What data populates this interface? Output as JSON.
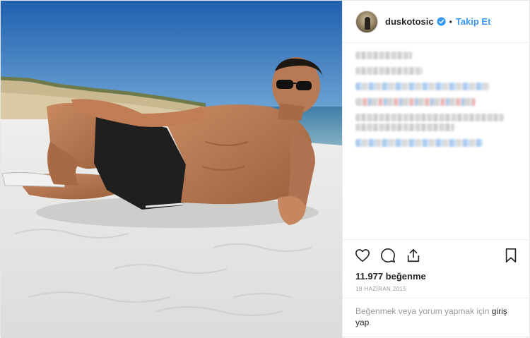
{
  "photo": {
    "description_icon": "beach-photo"
  },
  "header": {
    "username": "duskotosic",
    "separator": "•",
    "follow_label": "Takip Et"
  },
  "actions": {
    "like_icon": "heart-icon",
    "comment_icon": "comment-icon",
    "share_icon": "share-icon",
    "save_icon": "bookmark-icon"
  },
  "stats": {
    "likes": "11.977 beğenme",
    "date": "18 HAZİRAN 2015"
  },
  "login_prompt": {
    "text": "Beğenmek veya yorum yapmak için ",
    "link": "giriş yap",
    "suffix": "."
  },
  "colors": {
    "accent": "#3897f0",
    "verified": "#3897f0",
    "text": "#262626",
    "muted": "#999999"
  }
}
